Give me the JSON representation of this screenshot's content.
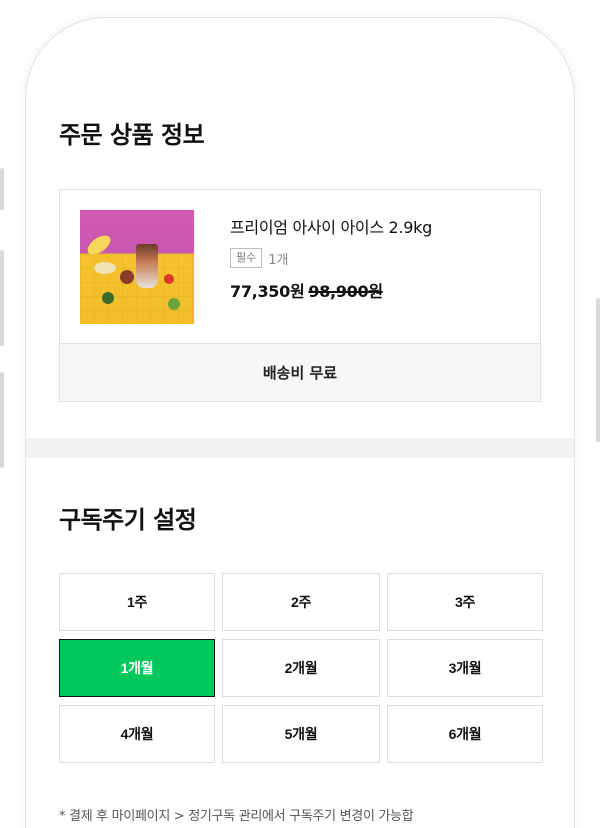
{
  "product_section": {
    "title": "주문 상품 정보",
    "product": {
      "name": "프리이엄 아사이 아이스 2.9kg",
      "badge": "필수",
      "quantity": "1개",
      "price": "77,350원",
      "original_price": "98,900원"
    },
    "shipping": "배송비 무료"
  },
  "cycle_section": {
    "title": "구독주기 설정",
    "options": [
      "1주",
      "2주",
      "3주",
      "1개월",
      "2개월",
      "3개월",
      "4개월",
      "5개월",
      "6개월"
    ],
    "selected": "1개월",
    "note": "* 결제 후 마이페이지 > 정기구독 관리에서 구독주기 변경이 가능합"
  },
  "colors": {
    "accent": "#03c75a"
  }
}
